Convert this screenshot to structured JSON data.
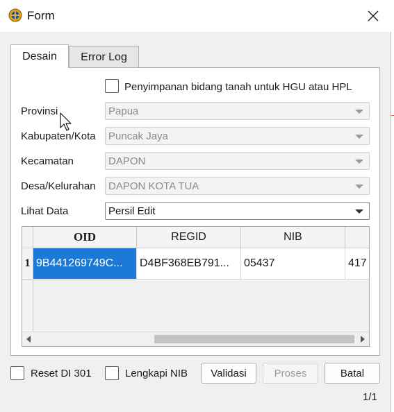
{
  "window": {
    "title": "Form",
    "icon": "globe-app-icon",
    "close_icon": "close-icon"
  },
  "tabs": [
    {
      "label": "Desain",
      "active": true
    },
    {
      "label": "Error Log",
      "active": false
    }
  ],
  "form": {
    "hgu_checkbox_label": "Penyimpanan bidang tanah untuk HGU atau HPL",
    "hgu_checked": false,
    "fields": [
      {
        "label": "Provinsi",
        "value": "Papua",
        "enabled": false
      },
      {
        "label": "Kabupaten/Kota",
        "value": "Puncak Jaya",
        "enabled": false
      },
      {
        "label": "Kecamatan",
        "value": "DAPON",
        "enabled": false
      },
      {
        "label": "Desa/Kelurahan",
        "value": "DAPON KOTA TUA",
        "enabled": false
      },
      {
        "label": "Lihat Data",
        "value": "Persil Edit",
        "enabled": true
      }
    ]
  },
  "table": {
    "columns": [
      "OID",
      "REGID",
      "NIB",
      ""
    ],
    "rows": [
      {
        "num": "1",
        "cells": [
          "9B441269749C...",
          "D4BF368EB791...",
          "05437",
          "417"
        ],
        "selected_col": 0
      }
    ]
  },
  "footer": {
    "reset_label": "Reset DI 301",
    "reset_checked": false,
    "lengkapi_label": "Lengkapi NIB",
    "lengkapi_checked": false,
    "validasi_label": "Validasi",
    "proses_label": "Proses",
    "proses_enabled": false,
    "batal_label": "Batal",
    "page_indicator": "1/1"
  },
  "colors": {
    "selection": "#1c7ad6",
    "window_bg": "#f0f0f0"
  }
}
